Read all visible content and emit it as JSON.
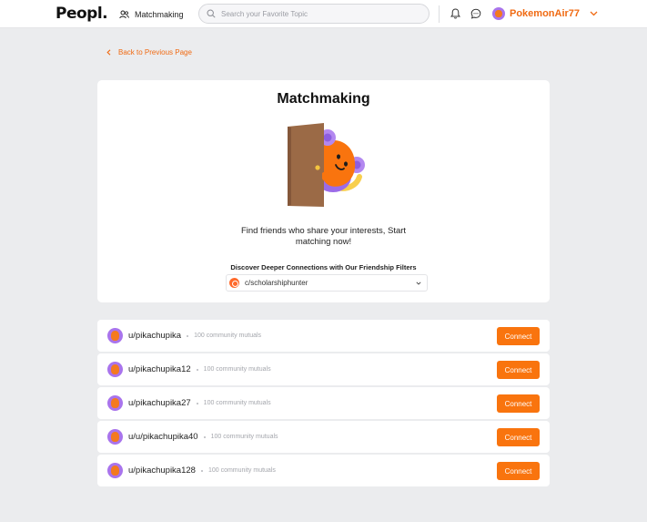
{
  "header": {
    "logo": "Peopl.",
    "nav_label": "Matchmaking",
    "search_placeholder": "Search your Favorite Topic",
    "username": "PokemonAir77"
  },
  "back_link": "Back to Previous Page",
  "hero": {
    "title": "Matchmaking",
    "description": "Find friends who share your interests, Start matching now!",
    "filter_label": "Discover Deeper Connections with Our Friendship Filters",
    "filter_value": "c/scholarshiphunter"
  },
  "matches": [
    {
      "name": "u/pikachupika",
      "mutuals": "100 community mutuals",
      "action": "Connect"
    },
    {
      "name": "u/pikachupika12",
      "mutuals": "100 community mutuals",
      "action": "Connect"
    },
    {
      "name": "u/pikachupika27",
      "mutuals": "100 community mutuals",
      "action": "Connect"
    },
    {
      "name": "u/u/pikachupika40",
      "mutuals": "100 community mutuals",
      "action": "Connect"
    },
    {
      "name": "u/pikachupika128",
      "mutuals": "100 community mutuals",
      "action": "Connect"
    }
  ],
  "colors": {
    "accent": "#f9740e",
    "avatar_bg": "#a974ec",
    "page_bg": "#ebecee"
  }
}
